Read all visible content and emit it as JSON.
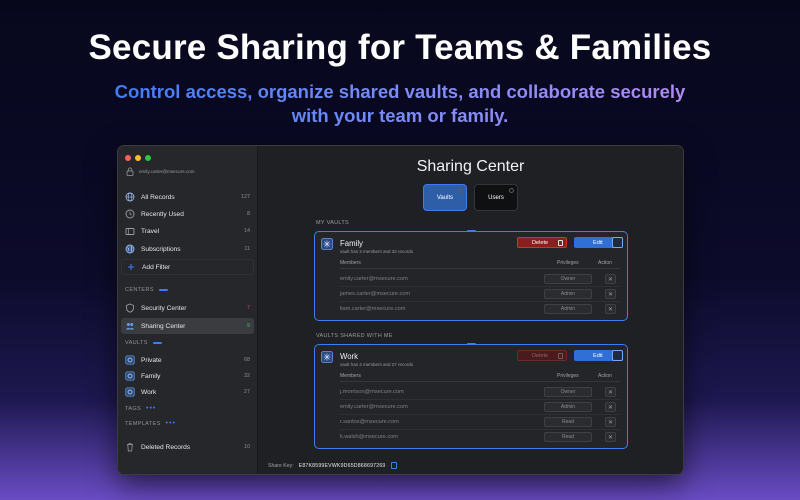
{
  "hero": {
    "title": "Secure Sharing for Teams & Families",
    "subtitle": "Control access, organize shared vaults, and collaborate securely with your team or family."
  },
  "window": {
    "traffic_lights": [
      "#ff5f57",
      "#febc2e",
      "#28c840"
    ],
    "account_email": "emily.carter@msecure.com"
  },
  "sidebar": {
    "items": [
      {
        "label": "All Records",
        "count": "127",
        "icon": "globe-icon"
      },
      {
        "label": "Recently Used",
        "count": "8",
        "icon": "clock-icon"
      },
      {
        "label": "Travel",
        "count": "14",
        "icon": "folder-icon"
      },
      {
        "label": "Subscriptions",
        "count": "11",
        "icon": "globe-icon"
      },
      {
        "label": "Add Filter",
        "count": "",
        "icon": "plus-icon"
      }
    ],
    "centers_label": "CENTERS",
    "centers": [
      {
        "label": "Security Center",
        "count": "7",
        "icon": "shield-icon"
      },
      {
        "label": "Sharing Center",
        "count": "9",
        "icon": "people-icon"
      }
    ],
    "vaults_label": "VAULTS",
    "vaults": [
      {
        "label": "Private",
        "count": "68",
        "icon": "vault-icon"
      },
      {
        "label": "Family",
        "count": "32",
        "icon": "vault-icon"
      },
      {
        "label": "Work",
        "count": "27",
        "icon": "vault-icon"
      }
    ],
    "tags_label": "TAGS",
    "templates_label": "TEMPLATES",
    "deleted": {
      "label": "Deleted Records",
      "count": "10",
      "icon": "trash-icon"
    }
  },
  "main": {
    "title": "Sharing Center",
    "tabs": [
      {
        "label": "Vaults"
      },
      {
        "label": "Users"
      }
    ],
    "my_vaults_label": "MY VAULTS",
    "shared_label": "VAULTS SHARED WITH ME",
    "columns": {
      "members": "Members",
      "privileges": "Privileges",
      "action": "Action"
    },
    "delete_label": "Delete",
    "edit_label": "Edit",
    "my_vault": {
      "name": "Family",
      "meta": "vault has 3 members and 32 records",
      "members": [
        {
          "email": "emily.carter@msecure.com",
          "privilege": "Owner"
        },
        {
          "email": "james.carter@msecure.com",
          "privilege": "Admin"
        },
        {
          "email": "liam.carter@msecure.com",
          "privilege": "Admin"
        }
      ]
    },
    "shared_vault": {
      "name": "Work",
      "meta": "vault has 4 members and 27 records",
      "members": [
        {
          "email": "j.morrison@msecure.com",
          "privilege": "Owner"
        },
        {
          "email": "emily.carter@msecure.com",
          "privilege": "Admin"
        },
        {
          "email": "r.santos@msecure.com",
          "privilege": "Read"
        },
        {
          "email": "k.walsh@msecure.com",
          "privilege": "Read"
        }
      ]
    },
    "share_key_label": "Share Key:",
    "share_key_value": "E87K8599EVWK9D65D868697269",
    "action_glyph": "✕",
    "fab_glyph": "+"
  },
  "colors": {
    "accent": "#3d7cf5",
    "danger": "#c0392b",
    "success": "#49b46a"
  }
}
